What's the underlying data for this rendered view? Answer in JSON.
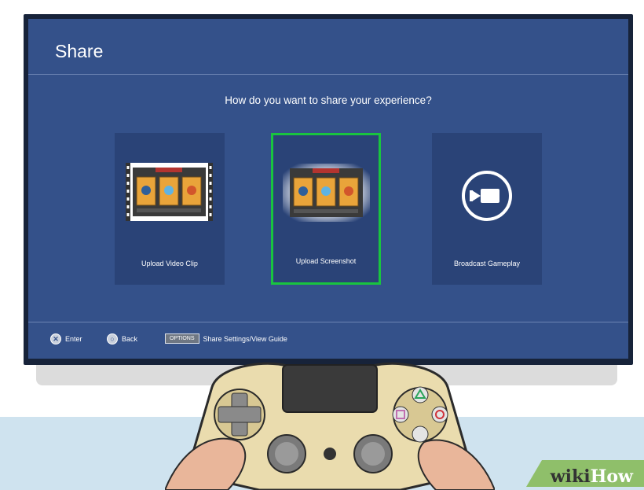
{
  "screen": {
    "title": "Share",
    "question": "How do you want to share your experience?"
  },
  "options": [
    {
      "label": "Upload Video Clip",
      "icon": "video-clip-thumbnail-icon",
      "selected": false
    },
    {
      "label": "Upload Screenshot",
      "icon": "screenshot-thumbnail-icon",
      "selected": true
    },
    {
      "label": "Broadcast Gameplay",
      "icon": "camera-icon",
      "selected": false
    }
  ],
  "footer": {
    "enter_symbol": "✕",
    "enter_label": "Enter",
    "back_symbol": "○",
    "back_label": "Back",
    "options_key": "OPTIONS",
    "options_label": "Share Settings/View Guide"
  },
  "watermark": {
    "prefix": "wiki",
    "suffix": "How"
  },
  "colors": {
    "screen_bg": "#34518a",
    "card_bg": "#2a4377",
    "selection": "#19c43f",
    "bezel": "#17233a",
    "controller": "#eadcae"
  }
}
